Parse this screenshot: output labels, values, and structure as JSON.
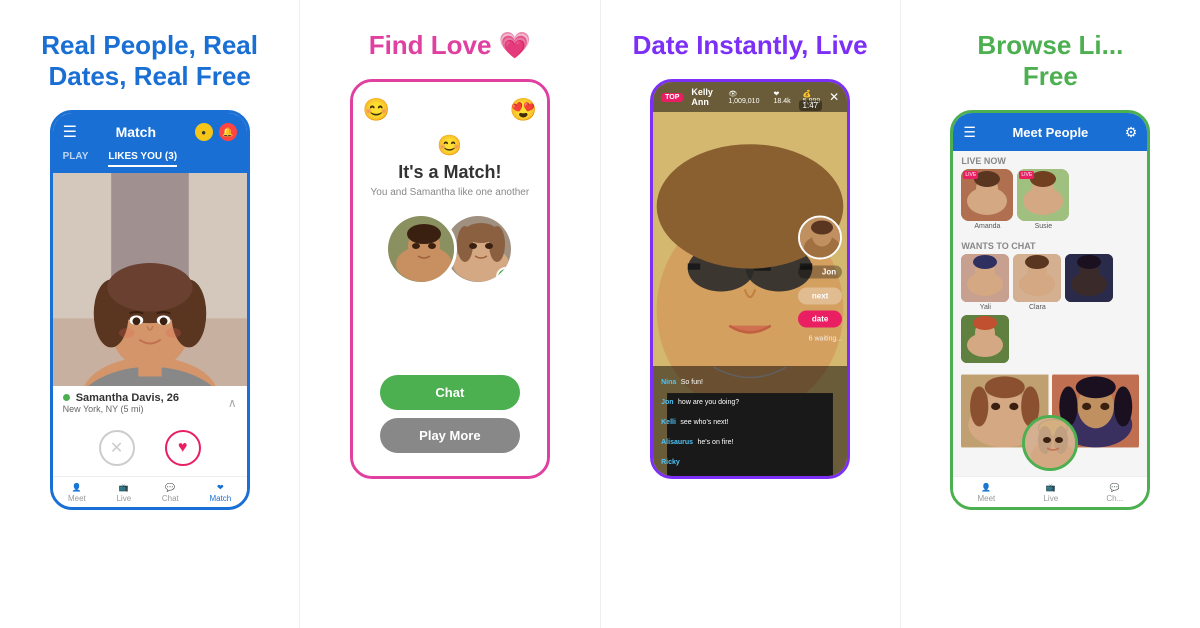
{
  "col1": {
    "headline": "Real People, Real Dates, Real Free",
    "headline_color": "blue",
    "phone": {
      "header_title": "Match",
      "tabs": [
        "PLAY",
        "LIKES YOU (3)"
      ],
      "person_name": "Samantha Davis, 26",
      "person_location": "New York, NY (5 mi)",
      "actions": [
        "✕",
        "♥"
      ],
      "nav_items": [
        "Meet",
        "Live",
        "Chat",
        "Match"
      ]
    }
  },
  "col2": {
    "headline": "Find Love 💗",
    "headline_color": "pink",
    "phone": {
      "match_title": "It's a Match!",
      "match_sub": "You and Samantha like one another",
      "emojis_left": "😊",
      "emojis_right": "😍",
      "btn_chat": "Chat",
      "btn_more": "Play More"
    }
  },
  "col3": {
    "headline": "Date Instantly, Live",
    "headline_color": "purple",
    "phone": {
      "user_name": "Kelly Ann",
      "stats": [
        "1,009,010",
        "18.4k",
        "5,999"
      ],
      "timer": "1:47",
      "btn_next": "next",
      "btn_date": "date",
      "waiting": "6 waiting...",
      "chat_messages": [
        {
          "name": "Nina",
          "text": "So fun!"
        },
        {
          "name": "Jon",
          "text": "how are you doing?"
        },
        {
          "name": "Kelli",
          "text": "see who's next!"
        },
        {
          "name": "Alisaurus",
          "text": "he's on fire!"
        },
        {
          "name": "Ricky",
          "text": ""
        }
      ]
    }
  },
  "col4": {
    "headline": "Browse Li... Free",
    "headline_color": "green",
    "phone": {
      "header_title": "Meet People",
      "live_now_label": "LIVE NOW",
      "wants_chat_label": "WANTS TO CHAT",
      "live_users": [
        "Amanda",
        "Susie"
      ],
      "chat_users": [
        "Yali",
        "Clara",
        "",
        ""
      ],
      "nav_items": [
        "Meet",
        "Live",
        "Ch..."
      ]
    }
  }
}
